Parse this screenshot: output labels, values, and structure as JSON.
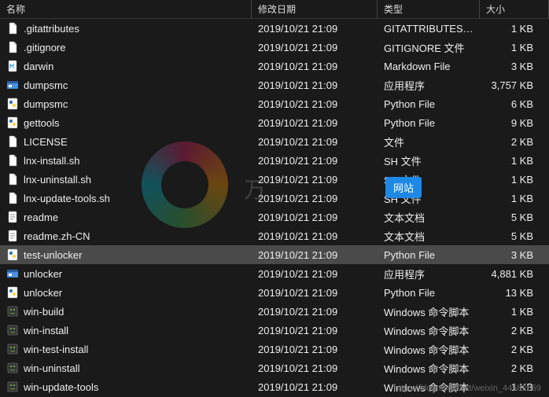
{
  "header": {
    "name": "名称",
    "date": "修改日期",
    "type": "类型",
    "size": "大小"
  },
  "badge": "网站",
  "watermark_text": "万",
  "footer": "https://blog.csdn.net/weixin_44582659",
  "files": [
    {
      "icon": "file",
      "name": ".gitattributes",
      "date": "2019/10/21 21:09",
      "type": "GITATTRIBUTES ...",
      "size": "1 KB",
      "selected": false
    },
    {
      "icon": "file",
      "name": ".gitignore",
      "date": "2019/10/21 21:09",
      "type": "GITIGNORE 文件",
      "size": "1 KB",
      "selected": false
    },
    {
      "icon": "markdown",
      "name": "darwin",
      "date": "2019/10/21 21:09",
      "type": "Markdown File",
      "size": "3 KB",
      "selected": false
    },
    {
      "icon": "exe",
      "name": "dumpsmc",
      "date": "2019/10/21 21:09",
      "type": "应用程序",
      "size": "3,757 KB",
      "selected": false
    },
    {
      "icon": "python",
      "name": "dumpsmc",
      "date": "2019/10/21 21:09",
      "type": "Python File",
      "size": "6 KB",
      "selected": false
    },
    {
      "icon": "python",
      "name": "gettools",
      "date": "2019/10/21 21:09",
      "type": "Python File",
      "size": "9 KB",
      "selected": false
    },
    {
      "icon": "file",
      "name": "LICENSE",
      "date": "2019/10/21 21:09",
      "type": "文件",
      "size": "2 KB",
      "selected": false
    },
    {
      "icon": "sh",
      "name": "lnx-install.sh",
      "date": "2019/10/21 21:09",
      "type": "SH 文件",
      "size": "1 KB",
      "selected": false
    },
    {
      "icon": "sh",
      "name": "lnx-uninstall.sh",
      "date": "2019/10/21 21:09",
      "type": "SH 文件",
      "size": "1 KB",
      "selected": false
    },
    {
      "icon": "sh",
      "name": "lnx-update-tools.sh",
      "date": "2019/10/21 21:09",
      "type": "SH 文件",
      "size": "1 KB",
      "selected": false
    },
    {
      "icon": "text",
      "name": "readme",
      "date": "2019/10/21 21:09",
      "type": "文本文档",
      "size": "5 KB",
      "selected": false
    },
    {
      "icon": "text",
      "name": "readme.zh-CN",
      "date": "2019/10/21 21:09",
      "type": "文本文档",
      "size": "5 KB",
      "selected": false
    },
    {
      "icon": "python",
      "name": "test-unlocker",
      "date": "2019/10/21 21:09",
      "type": "Python File",
      "size": "3 KB",
      "selected": true
    },
    {
      "icon": "exe",
      "name": "unlocker",
      "date": "2019/10/21 21:09",
      "type": "应用程序",
      "size": "4,881 KB",
      "selected": false
    },
    {
      "icon": "python",
      "name": "unlocker",
      "date": "2019/10/21 21:09",
      "type": "Python File",
      "size": "13 KB",
      "selected": false
    },
    {
      "icon": "batch",
      "name": "win-build",
      "date": "2019/10/21 21:09",
      "type": "Windows 命令脚本",
      "size": "1 KB",
      "selected": false
    },
    {
      "icon": "batch",
      "name": "win-install",
      "date": "2019/10/21 21:09",
      "type": "Windows 命令脚本",
      "size": "2 KB",
      "selected": false
    },
    {
      "icon": "batch",
      "name": "win-test-install",
      "date": "2019/10/21 21:09",
      "type": "Windows 命令脚本",
      "size": "2 KB",
      "selected": false
    },
    {
      "icon": "batch",
      "name": "win-uninstall",
      "date": "2019/10/21 21:09",
      "type": "Windows 命令脚本",
      "size": "2 KB",
      "selected": false
    },
    {
      "icon": "batch",
      "name": "win-update-tools",
      "date": "2019/10/21 21:09",
      "type": "Windows 命令脚本",
      "size": "1 KB",
      "selected": false
    }
  ],
  "icon_colors": {
    "file": "#e8e8e8",
    "python": "#3776ab",
    "exe": "#ffd966",
    "sh": "#e8e8e8",
    "text": "#e8e8e8",
    "batch": "#c0c0c0",
    "markdown": "#42a5f5"
  }
}
